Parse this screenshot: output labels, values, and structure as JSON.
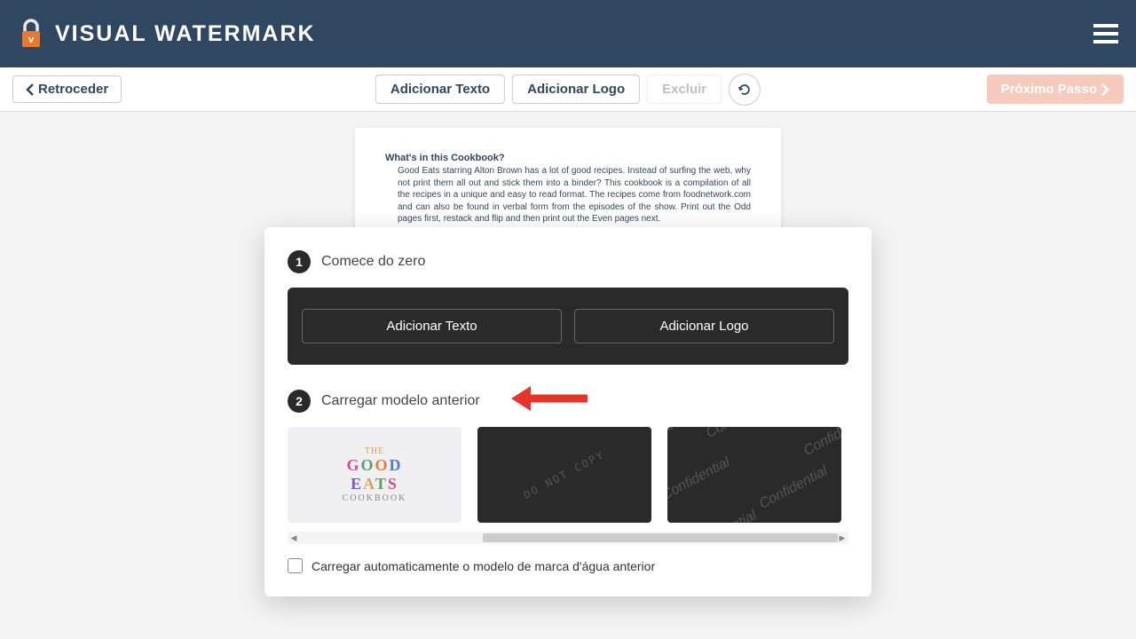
{
  "header": {
    "brand": "VISUAL WATERMARK"
  },
  "toolbar": {
    "back": "Retroceder",
    "add_text": "Adicionar Texto",
    "add_logo": "Adicionar Logo",
    "delete": "Excluir",
    "next": "Próximo Passo"
  },
  "document": {
    "title": "What's in this Cookbook?",
    "body": "Good Eats starring Alton Brown has a lot of good recipes. Instead of surfing the web, why not print them all out and stick them into a binder? This cookbook is a compilation of all the recipes in a unique and easy to read format. The recipes come from foodnetwork.com and can also be found in verbal form from the episodes of the show. Print out the Odd pages first, restack and flip and then print out the Even pages next."
  },
  "modal": {
    "section1": {
      "num": "1",
      "label": "Comece do zero",
      "add_text": "Adicionar Texto",
      "add_logo": "Adicionar Logo"
    },
    "section2": {
      "num": "2",
      "label": "Carregar modelo anterior"
    },
    "templates": {
      "cookbook": {
        "the": "THE",
        "good": "GOOD",
        "eats": "EATS",
        "sub": "COOKBOOK"
      },
      "do_not_copy": "DO NOT COPY",
      "confidential": "Confidential"
    },
    "auto_load": "Carregar automaticamente o modelo de marca d'água anterior"
  }
}
